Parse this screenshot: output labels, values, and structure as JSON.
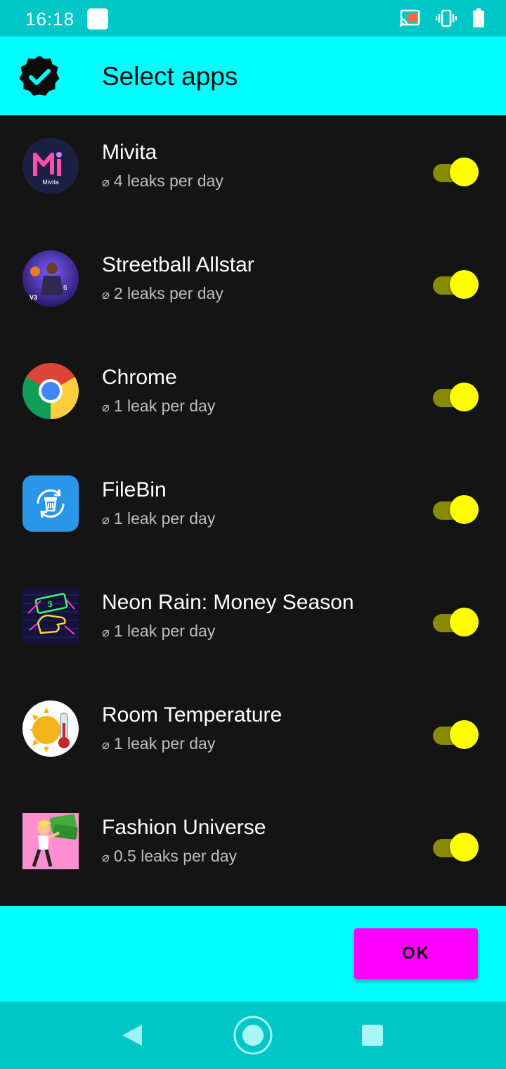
{
  "status_bar": {
    "time": "16:18",
    "icons": [
      "notification-square-icon",
      "cast-icon",
      "vibrate-icon",
      "battery-icon"
    ]
  },
  "app_bar": {
    "title": "Select apps",
    "icon": "verified-badge-icon"
  },
  "apps": [
    {
      "name": "Mivita",
      "leaks": "4 leaks per day",
      "enabled": true,
      "icon_label": "Mivita"
    },
    {
      "name": "Streetball Allstar",
      "leaks": "2 leaks per day",
      "enabled": true,
      "icon_label": "V3"
    },
    {
      "name": "Chrome",
      "leaks": "1 leak per day",
      "enabled": true
    },
    {
      "name": "FileBin",
      "leaks": "1 leak per day",
      "enabled": true
    },
    {
      "name": "Neon Rain: Money Season",
      "leaks": "1 leak per day",
      "enabled": true
    },
    {
      "name": "Room Temperature",
      "leaks": "1 leak per day",
      "enabled": true
    },
    {
      "name": "Fashion Universe",
      "leaks": "0.5 leaks per day",
      "enabled": true
    }
  ],
  "average_symbol": "⌀",
  "footer": {
    "ok_label": "OK"
  },
  "nav_bar": {
    "icons": [
      "back-icon",
      "home-icon",
      "recents-icon"
    ]
  },
  "colors": {
    "accent": "#00ffff",
    "status_bar": "#00c7c7",
    "toggle_thumb": "#ffff00",
    "ok_button": "#ff00ff",
    "background": "#141414"
  }
}
